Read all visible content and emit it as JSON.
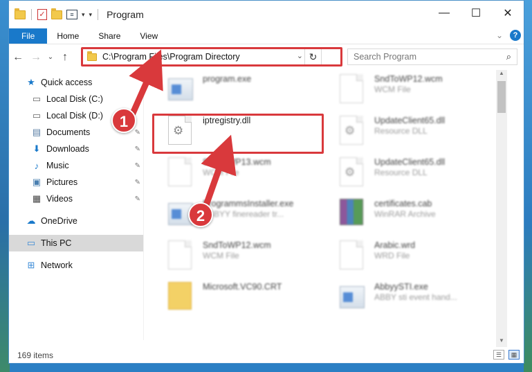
{
  "window": {
    "title": "Program",
    "controls": {
      "minimize": "—",
      "maximize": "☐",
      "close": "✕"
    }
  },
  "ribbon": {
    "tabs": [
      "File",
      "Home",
      "Share",
      "View"
    ],
    "help": "?"
  },
  "navigation": {
    "address": "C:\\Program Files\\Program Directory",
    "search_placeholder": "Search Program"
  },
  "sidebar": {
    "items": [
      {
        "label": "Quick access",
        "icon": "star-icon"
      },
      {
        "label": "Local Disk (C:)",
        "icon": "drive-icon"
      },
      {
        "label": "Local Disk (D:)",
        "icon": "drive-icon"
      },
      {
        "label": "Documents",
        "icon": "documents-icon"
      },
      {
        "label": "Downloads",
        "icon": "download-icon"
      },
      {
        "label": "Music",
        "icon": "music-icon"
      },
      {
        "label": "Pictures",
        "icon": "pictures-icon"
      },
      {
        "label": "Videos",
        "icon": "videos-icon"
      },
      {
        "label": "OneDrive",
        "icon": "cloud-icon"
      },
      {
        "label": "This PC",
        "icon": "pc-icon"
      },
      {
        "label": "Network",
        "icon": "network-icon"
      }
    ]
  },
  "files": [
    {
      "name": "program.exe",
      "type": ""
    },
    {
      "name": "SndToWP12.wcm",
      "type": "WCM File"
    },
    {
      "name": "iptregistry.dll",
      "type": ""
    },
    {
      "name": "UpdateClient65.dll",
      "type": "Resource DLL"
    },
    {
      "name": "SndToWP13.wcm",
      "type": "WCM File"
    },
    {
      "name": "UpdateClient65.dll",
      "type": "Resource DLL"
    },
    {
      "name": "ProgrammsInstaller.exe",
      "type": "ABBYY finereader tr..."
    },
    {
      "name": "certificates.cab",
      "type": "WinRAR Archive"
    },
    {
      "name": "SndToWP12.wcm",
      "type": "WCM File"
    },
    {
      "name": "Arabic.wrd",
      "type": "WRD File"
    },
    {
      "name": "Microsoft.VC90.CRT",
      "type": ""
    },
    {
      "name": "AbbyySTI.exe",
      "type": "ABBY sti event hand..."
    }
  ],
  "status": {
    "item_count": "169 items"
  },
  "annotations": {
    "step1": "1",
    "step2": "2"
  },
  "colors": {
    "highlight": "#d9393c",
    "accent": "#1979ca"
  }
}
